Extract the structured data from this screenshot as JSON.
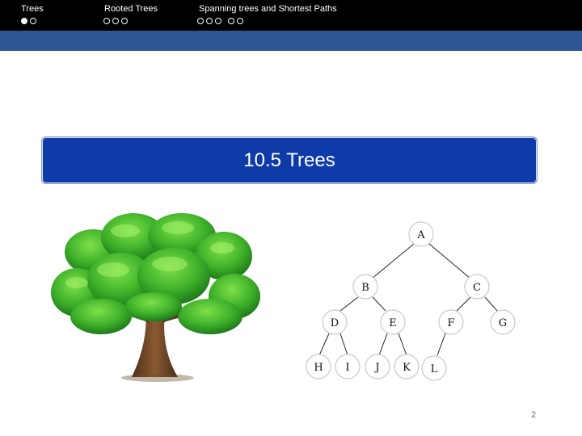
{
  "nav": {
    "sections": [
      {
        "label": "Trees",
        "dots": 2,
        "filled_index": 0
      },
      {
        "label": "Rooted Trees",
        "dots": 3
      },
      {
        "label": "Spanning trees and Shortest Paths",
        "dots": 5
      }
    ]
  },
  "slide": {
    "title": "10.5 Trees",
    "page_number": "2"
  },
  "diagram": {
    "nodes": [
      "A",
      "B",
      "C",
      "D",
      "E",
      "F",
      "G",
      "H",
      "I",
      "J",
      "K",
      "L"
    ]
  },
  "colors": {
    "top_bar": "#000000",
    "sub_bar": "#2f5597",
    "title_box": "#0f3ba8"
  }
}
